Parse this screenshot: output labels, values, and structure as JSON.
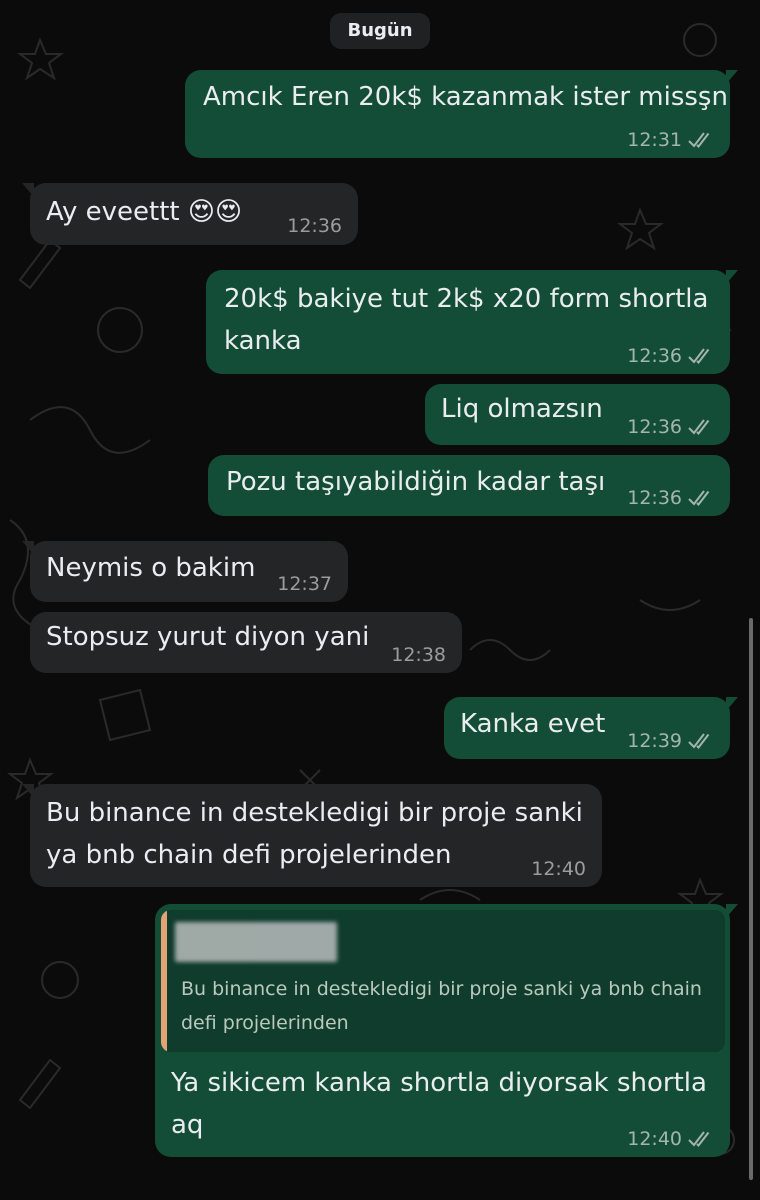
{
  "date_label": "Bugün",
  "colors": {
    "background": "#0b0b0b",
    "incoming_bubble": "#232526",
    "outgoing_bubble": "#144d37",
    "quote_bar": "#e2a474",
    "read_ticks": "#a3b6ac"
  },
  "messages": [
    {
      "direction": "out",
      "text": "Amcık Eren 20k$ kazanmak ister missşn",
      "time": "12:31",
      "status": "read-double-check-icon"
    },
    {
      "direction": "in",
      "text": "Ay eveettt 😍😍",
      "time": "12:36"
    },
    {
      "direction": "out",
      "lines": [
        "20k$ bakiye tut 2k$ x20 form shortla",
        "kanka"
      ],
      "time": "12:36",
      "status": "read-double-check-icon"
    },
    {
      "direction": "out",
      "text": "Liq olmazsın",
      "time": "12:36",
      "status": "read-double-check-icon"
    },
    {
      "direction": "out",
      "text": "Pozu taşıyabildiğin kadar taşı",
      "time": "12:36",
      "status": "read-double-check-icon"
    },
    {
      "direction": "in",
      "text": "Neymis o bakim",
      "time": "12:37"
    },
    {
      "direction": "in",
      "text": "Stopsuz yurut diyon yani",
      "time": "12:38"
    },
    {
      "direction": "out",
      "text": "Kanka evet",
      "time": "12:39",
      "status": "read-double-check-icon"
    },
    {
      "direction": "in",
      "lines": [
        "Bu binance in destekledigi bir proje sanki",
        "ya bnb chain defi projelerinden"
      ],
      "time": "12:40"
    },
    {
      "direction": "out",
      "quote": {
        "text": "Bu binance in destekledigi bir proje sanki ya bnb chain defi projelerinden"
      },
      "lines": [
        "Ya sikicem kanka shortla diyorsak shortla",
        "aq"
      ],
      "time": "12:40",
      "status": "read-double-check-icon"
    }
  ]
}
